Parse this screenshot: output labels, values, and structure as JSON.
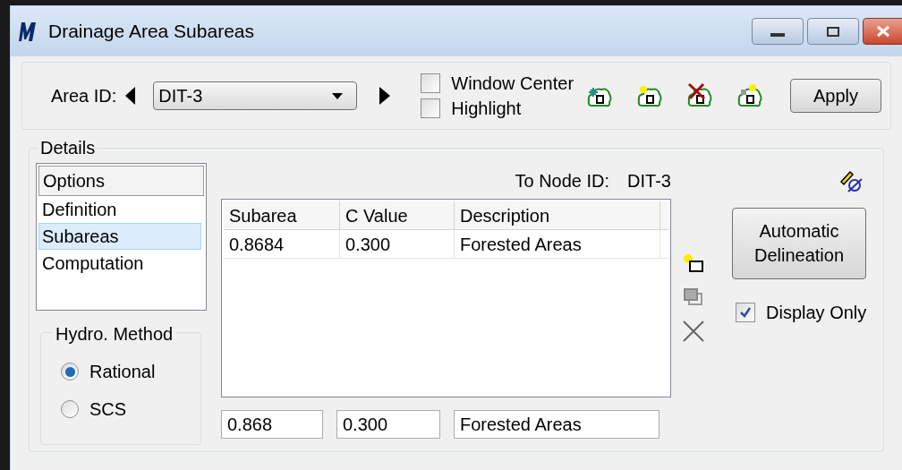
{
  "window": {
    "title": "Drainage Area Subareas"
  },
  "area": {
    "label": "Area ID:",
    "value": "DIT-3",
    "checkboxes": [
      {
        "label": "Window Center",
        "checked": false
      },
      {
        "label": "Highlight",
        "checked": false
      }
    ],
    "apply": "Apply"
  },
  "details": {
    "title": "Details",
    "options_header": "Options",
    "options": [
      {
        "label": "Definition",
        "selected": false
      },
      {
        "label": "Subareas",
        "selected": true
      },
      {
        "label": "Computation",
        "selected": false
      }
    ],
    "hydro": {
      "title": "Hydro. Method",
      "methods": [
        {
          "label": "Rational",
          "selected": true
        },
        {
          "label": "SCS",
          "selected": false
        }
      ]
    },
    "to_node": {
      "label": "To Node ID:",
      "value": "DIT-3"
    },
    "table": {
      "columns": [
        "Subarea",
        "C Value",
        "Description"
      ],
      "rows": [
        [
          "0.8684",
          "0.300",
          "Forested Areas"
        ]
      ]
    },
    "fields": [
      "0.868",
      "0.300",
      "Forested Areas"
    ],
    "automatic": "Automatic Delineation",
    "display_only": {
      "label": "Display Only",
      "checked": true
    }
  }
}
